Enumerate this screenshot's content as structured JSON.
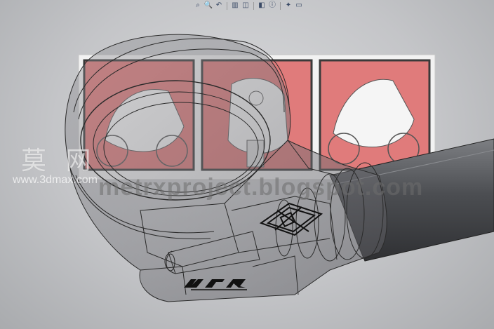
{
  "toolbar": {
    "buttons": [
      {
        "name": "zoom-fit",
        "glyph": "⌕"
      },
      {
        "name": "zoom-area",
        "glyph": "🔍"
      },
      {
        "name": "previous-view",
        "glyph": "↶"
      },
      {
        "name": "section-view",
        "glyph": "▥"
      },
      {
        "name": "view-orientation",
        "glyph": "◫"
      },
      {
        "name": "display-style",
        "glyph": "◧"
      },
      {
        "name": "hide-show-items",
        "glyph": "ⓘ"
      },
      {
        "name": "edit-appearance",
        "glyph": "✦"
      },
      {
        "name": "apply-scene",
        "glyph": "▭"
      }
    ]
  },
  "watermark": {
    "cn_text": "莫 网",
    "url_small": "www.3dmax.com",
    "url_big": "metrxproject.blogspot.com"
  },
  "logo": {
    "label": "MTR"
  },
  "colors": {
    "panel_red": "#e07b7b",
    "panel_frame": "#3a3a3a",
    "wire": "#2a2a2a",
    "bar": "#5d5f63"
  }
}
